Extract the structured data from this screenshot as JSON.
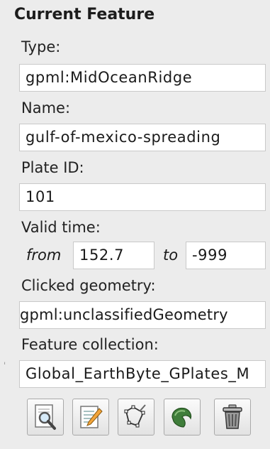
{
  "panel": {
    "title": "Current Feature",
    "type_label": "Type:",
    "type_value": "gpml:MidOceanRidge",
    "name_label": "Name:",
    "name_value": "gulf-of-mexico-spreading",
    "plate_label": "Plate ID:",
    "plate_value": "101",
    "valid_time_label": "Valid time:",
    "from_label": "from",
    "from_value": "152.7",
    "to_label": "to",
    "to_value": "-999",
    "geometry_label": "Clicked geometry:",
    "geometry_value": "gpml:unclassifiedGeometry",
    "collection_label": "Feature collection:",
    "collection_value": "Global_EarthByte_GPlates_M"
  },
  "toolbar": {
    "buttons": [
      {
        "icon": "query-magnifier-icon"
      },
      {
        "icon": "edit-notepad-icon"
      },
      {
        "icon": "digitise-geometry-icon"
      },
      {
        "icon": "reconstruction-pole-icon"
      },
      {
        "icon": "trash-can-icon"
      }
    ]
  },
  "colors": {
    "panel_bg": "#ececec",
    "field_bg": "#ffffff",
    "field_border": "#c9c9c9",
    "pencil_orange": "#f2a43a",
    "plate_green": "#3f7d3a"
  }
}
